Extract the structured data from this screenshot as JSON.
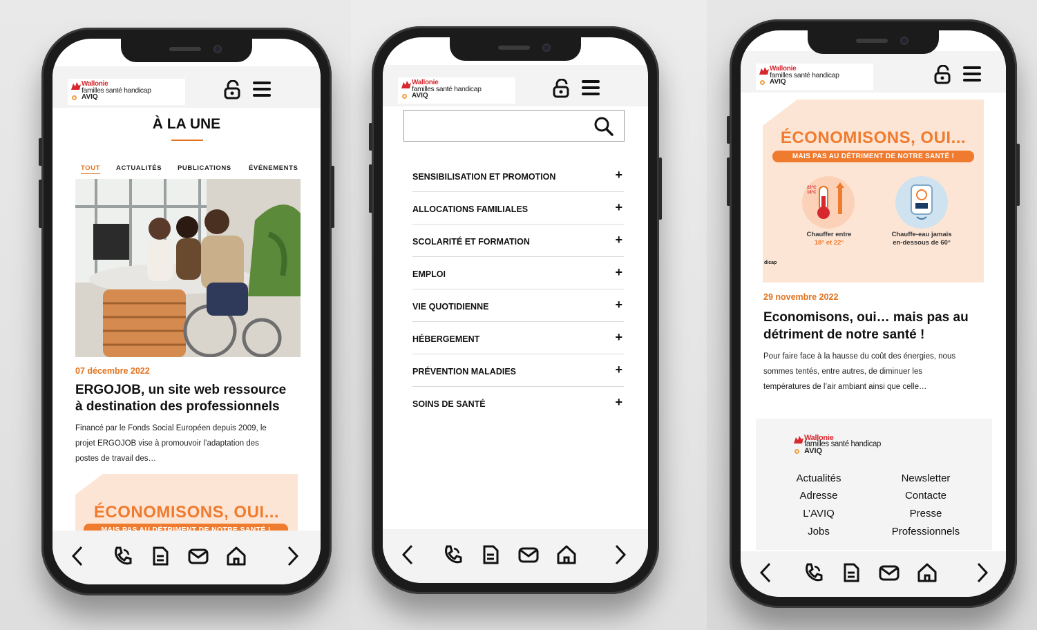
{
  "brand": {
    "line1": "Wallonie",
    "line2": "familles santé handicap",
    "line3": "AVIQ",
    "accent": "#e2731f",
    "red": "#d7282f"
  },
  "screen1": {
    "title": "À LA UNE",
    "tabs": [
      "TOUT",
      "ACTUALITÉS",
      "PUBLICATIONS",
      "ÉVÉNEMENTS"
    ],
    "article": {
      "date": "07 décembre 2022",
      "headline_1": "ERGOJOB, un site web ressource",
      "headline_2": "à destination des professionnels",
      "excerpt_1": "Financé par le Fonds Social Européen depuis 2009, le",
      "excerpt_2": "projet ERGOJOB vise à promouvoir l’adaptation des",
      "excerpt_3": "postes de travail des…"
    },
    "promo": {
      "big": "ÉCONOMISONS, OUI...",
      "pill": "MAIS PAS AU DÉTRIMENT DE NOTRE SANTÉ !"
    }
  },
  "screen2": {
    "search_placeholder": "",
    "menu": [
      "SENSIBILISATION ET PROMOTION",
      "ALLOCATIONS FAMILIALES",
      "SCOLARITÉ ET FORMATION",
      "EMPLOI",
      "VIE QUOTIDIENNE",
      "HÉBERGEMENT",
      "PRÉVENTION MALADIES",
      "SOINS DE SANTÉ"
    ],
    "expand_symbol": "+"
  },
  "screen3": {
    "promo": {
      "big": "ÉCONOMISONS, OUI...",
      "pill": "MAIS PAS AU DÉTRIMENT DE NOTRE SANTÉ !",
      "thermo_temps": "22°C 18°C",
      "left_caption_1": "Chauffer entre",
      "left_caption_2": "18° et 22°",
      "right_caption_1": "Chauffe-eau jamais",
      "right_caption_2": "en-dessous de 60°",
      "corner_text": "dicap"
    },
    "article": {
      "date": "29 novembre 2022",
      "headline_1": "Economisons, oui… mais pas au",
      "headline_2": "détriment de notre santé !",
      "excerpt_1": "Pour faire face à la hausse du coût des énergies, nous",
      "excerpt_2": "sommes tentés, entre autres, de diminuer les",
      "excerpt_3": "températures de l’air ambiant ainsi que celle…"
    },
    "footer_links_left": [
      "Actualités",
      "Adresse",
      "L’AVIQ",
      "Jobs"
    ],
    "footer_links_right": [
      "Newsletter",
      "Contacte",
      "Presse",
      "Professionnels"
    ]
  },
  "bottom_nav": {
    "icons": [
      "chevron-left-icon",
      "phone-icon",
      "document-icon",
      "mail-icon",
      "home-icon",
      "chevron-right-icon"
    ]
  }
}
